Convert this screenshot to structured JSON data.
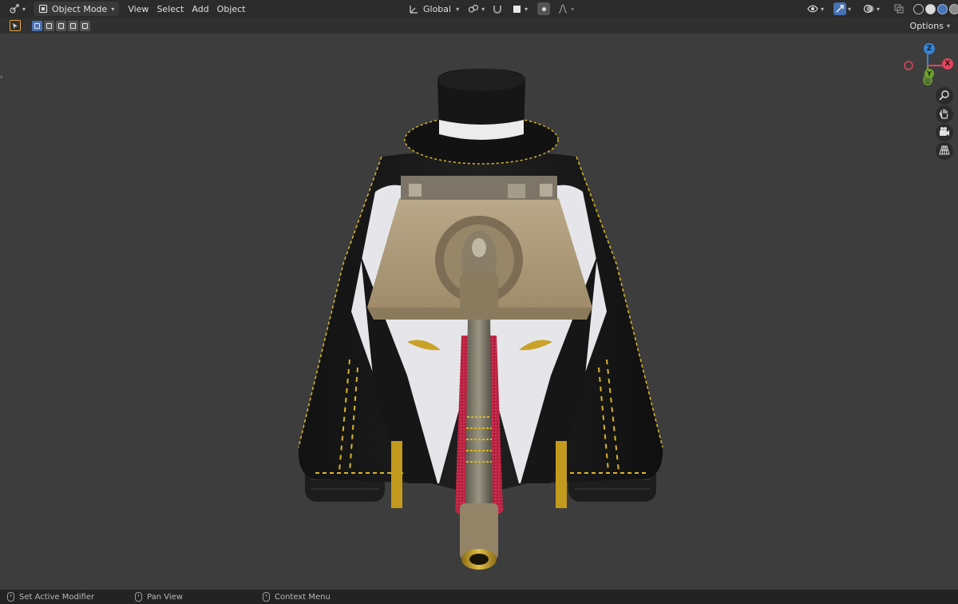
{
  "header": {
    "editor_type_icon": "3d-viewport-icon",
    "mode_label": "Object Mode",
    "menus": [
      "View",
      "Select",
      "Add",
      "Object"
    ],
    "transform_orientation": "Global",
    "options_label": "Options"
  },
  "viewport": {
    "gizmo": {
      "z": "Z",
      "x": "X",
      "y": "Y"
    },
    "nav_buttons": [
      "zoom-icon",
      "hand-icon",
      "camera-icon",
      "grid-icon"
    ]
  },
  "statusbar": {
    "items": [
      {
        "icon": "mouse-left-icon",
        "label": "Set Active Modifier"
      },
      {
        "icon": "mouse-middle-icon",
        "label": "Pan View"
      },
      {
        "icon": "mouse-right-icon",
        "label": "Context Menu"
      }
    ]
  },
  "colors": {
    "accent": "#4772b3",
    "axis_x": "#e2445b",
    "axis_y": "#6fa22c",
    "axis_z": "#3a84d6"
  }
}
